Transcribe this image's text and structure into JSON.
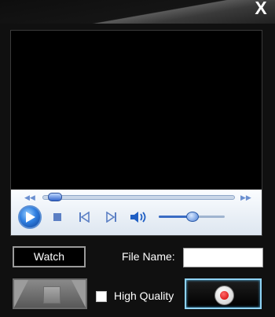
{
  "window": {
    "close_label": "X"
  },
  "player": {
    "seek_progress": 0.03,
    "volume_level": 0.5
  },
  "capture": {
    "watch_label": "Watch",
    "filename_label": "File Name:",
    "filename_value": "",
    "high_quality_label": "High Quality",
    "high_quality_checked": false
  },
  "colors": {
    "background": "#101010",
    "control_bar": "#e8eef6",
    "accent_blue": "#2f7fe0",
    "record_red": "#d00000",
    "record_border": "#8fd3f5"
  },
  "icons": {
    "close": "close-icon",
    "play": "play-icon",
    "stop": "stop-icon",
    "previous": "previous-icon",
    "next": "next-icon",
    "volume": "volume-icon",
    "record": "record-icon",
    "stop_record": "stop-icon"
  }
}
